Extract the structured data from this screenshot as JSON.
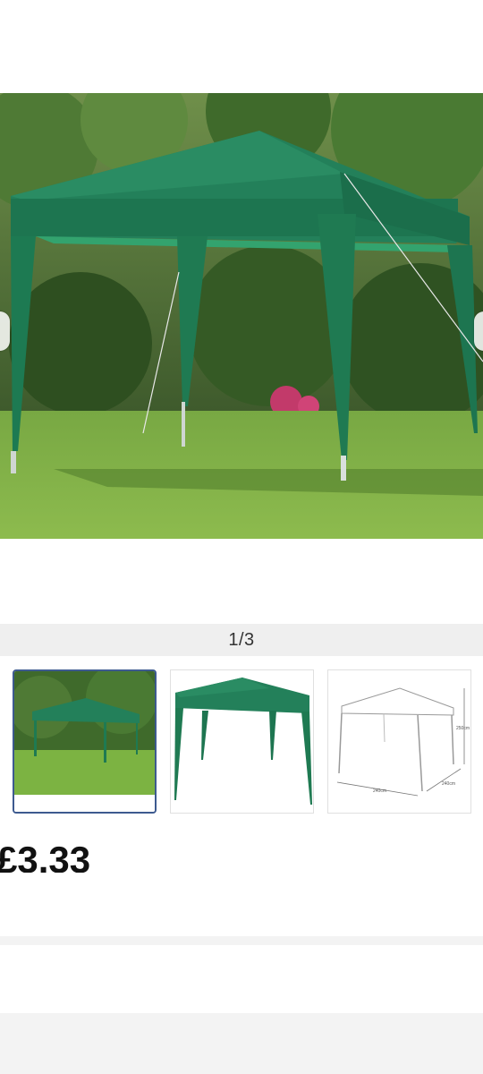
{
  "gallery": {
    "counter": "1/3",
    "selected_index": 0,
    "thumbnails": [
      {
        "alt": "green gazebo in garden"
      },
      {
        "alt": "green gazebo on white"
      },
      {
        "alt": "gazebo dimensions diagram",
        "labels": [
          "240cm",
          "240cm",
          "250cm"
        ]
      }
    ]
  },
  "listing": {
    "price_partial": "£3.33"
  },
  "colors": {
    "canopy": "#1f7a52",
    "selected_border": "#3d5a8f",
    "grass": "#7cb342"
  }
}
